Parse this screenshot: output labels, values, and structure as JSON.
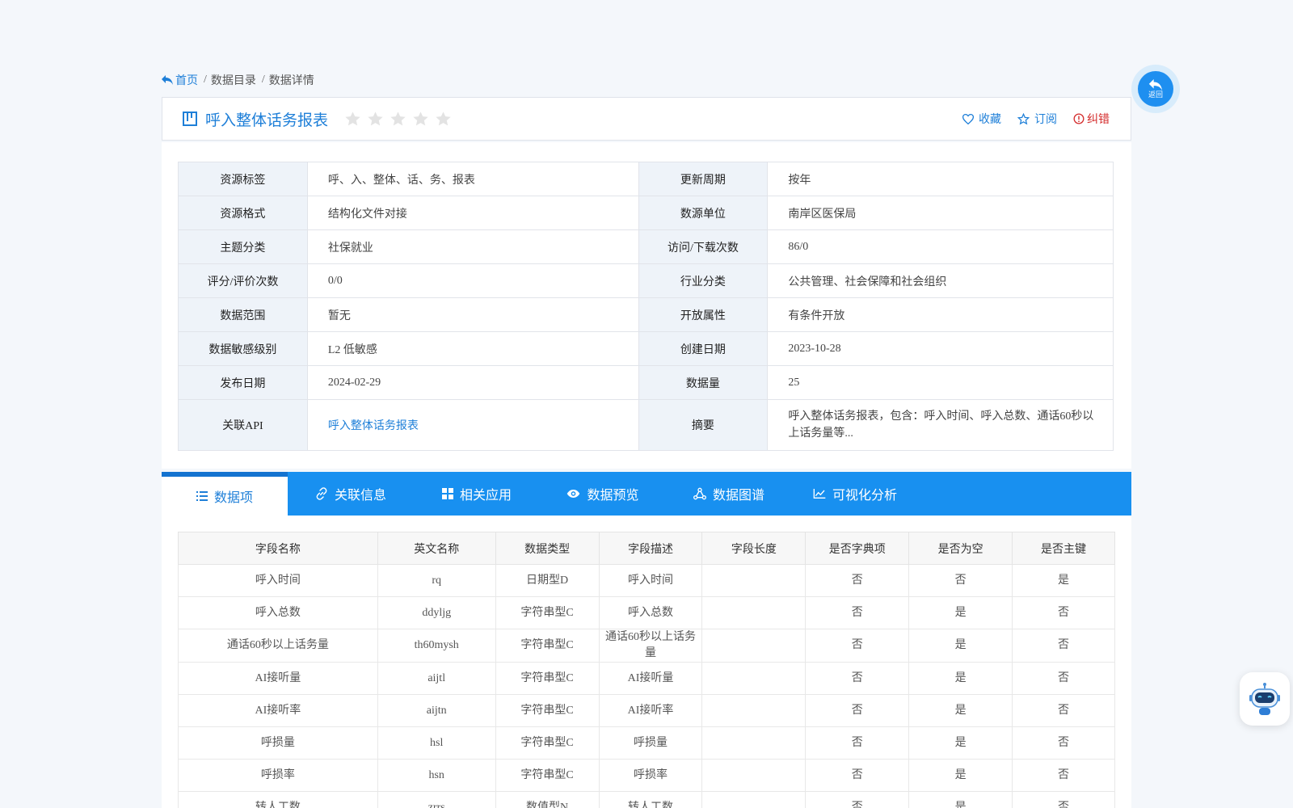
{
  "breadcrumb": {
    "home": "首页",
    "sep": "/",
    "catalog": "数据目录",
    "detail": "数据详情"
  },
  "title": {
    "text": "呼入整体话务报表",
    "rating_stars": 0,
    "star_count": 5
  },
  "actions": {
    "favorite": "收藏",
    "subscribe": "订阅",
    "report_error": "纠错"
  },
  "info": {
    "rows": [
      {
        "l1": "资源标签",
        "v1": "呼、入、整体、话、务、报表",
        "l2": "更新周期",
        "v2": "按年"
      },
      {
        "l1": "资源格式",
        "v1": "结构化文件对接",
        "l2": "数源单位",
        "v2": "南岸区医保局"
      },
      {
        "l1": "主题分类",
        "v1": "社保就业",
        "l2": "访问/下载次数",
        "v2": "86/0"
      },
      {
        "l1": "评分/评价次数",
        "v1": "0/0",
        "l2": "行业分类",
        "v2": "公共管理、社会保障和社会组织"
      },
      {
        "l1": "数据范围",
        "v1": "暂无",
        "l2": "开放属性",
        "v2": "有条件开放"
      },
      {
        "l1": "数据敏感级别",
        "v1": "L2 低敏感",
        "l2": "创建日期",
        "v2": "2023-10-28"
      },
      {
        "l1": "发布日期",
        "v1": "2024-02-29",
        "l2": "数据量",
        "v2": "25"
      }
    ],
    "api_label": "关联API",
    "api_link": "呼入整体话务报表",
    "abstract_label": "摘要",
    "abstract_text": "呼入整体话务报表，包含：呼入时间、呼入总数、通话60秒以上话务量等..."
  },
  "tabs": [
    {
      "label": "数据项",
      "icon": "list-icon"
    },
    {
      "label": "关联信息",
      "icon": "link-icon"
    },
    {
      "label": "相关应用",
      "icon": "grid-icon"
    },
    {
      "label": "数据预览",
      "icon": "eye-icon"
    },
    {
      "label": "数据图谱",
      "icon": "graph-icon"
    },
    {
      "label": "可视化分析",
      "icon": "line-chart-icon"
    }
  ],
  "fields": {
    "headers": [
      "字段名称",
      "英文名称",
      "数据类型",
      "字段描述",
      "字段长度",
      "是否字典项",
      "是否为空",
      "是否主键"
    ],
    "rows": [
      [
        "呼入时间",
        "rq",
        "日期型D",
        "呼入时间",
        "",
        "否",
        "否",
        "是"
      ],
      [
        "呼入总数",
        "ddyljg",
        "字符串型C",
        "呼入总数",
        "",
        "否",
        "是",
        "否"
      ],
      [
        "通话60秒以上话务量",
        "th60mysh",
        "字符串型C",
        "通话60秒以上话务量",
        "",
        "否",
        "是",
        "否"
      ],
      [
        "AI接听量",
        "aijtl",
        "字符串型C",
        "AI接听量",
        "",
        "否",
        "是",
        "否"
      ],
      [
        "AI接听率",
        "aijtn",
        "字符串型C",
        "AI接听率",
        "",
        "否",
        "是",
        "否"
      ],
      [
        "呼损量",
        "hsl",
        "字符串型C",
        "呼损量",
        "",
        "否",
        "是",
        "否"
      ],
      [
        "呼损率",
        "hsn",
        "字符串型C",
        "呼损率",
        "",
        "否",
        "是",
        "否"
      ],
      [
        "转人工数",
        "zrrs",
        "数值型N",
        "转人工数",
        "",
        "否",
        "是",
        "否"
      ]
    ]
  },
  "floating": {
    "back_label": "返回",
    "assistant_icon": "robot-icon"
  },
  "colors": {
    "accent": "#1e7fd8",
    "tabbar": "#1890f0",
    "error": "#d42b2b"
  }
}
